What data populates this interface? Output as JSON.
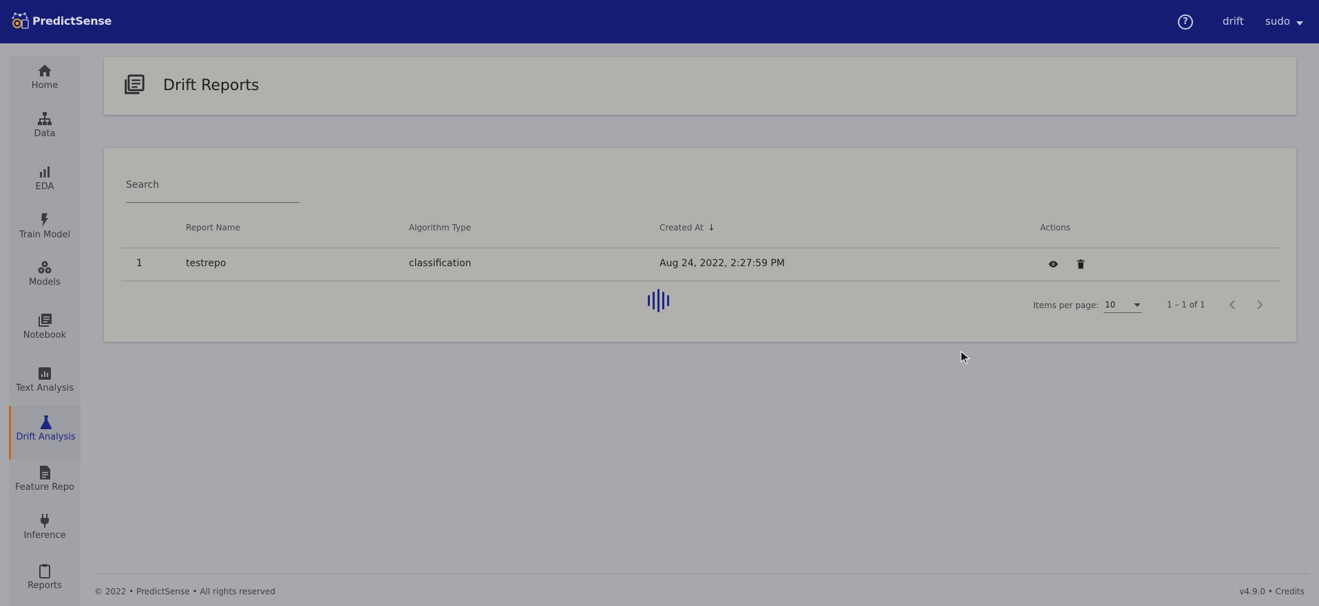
{
  "app": {
    "brand": "PredictSense",
    "colors": {
      "topbar": "#141c74",
      "accent": "#1d2680",
      "active_marker": "#c36520",
      "loader": "#1d2680"
    }
  },
  "topbar": {
    "help_icon": "question-circle-icon",
    "help_glyph": "?",
    "project": "drift",
    "user": "sudo"
  },
  "sidebar": {
    "items": [
      {
        "label": "Home",
        "icon": "home-icon",
        "active": false
      },
      {
        "label": "Data",
        "icon": "hierarchy-icon",
        "active": false
      },
      {
        "label": "EDA",
        "icon": "bar-chart-icon",
        "active": false
      },
      {
        "label": "Train Model",
        "icon": "bolt-icon",
        "active": false
      },
      {
        "label": "Models",
        "icon": "cubes-icon",
        "active": false
      },
      {
        "label": "Notebook",
        "icon": "notebook-icon",
        "active": false
      },
      {
        "label": "Text Analysis",
        "icon": "analytics-icon",
        "active": false
      },
      {
        "label": "Drift Analysis",
        "icon": "flask-icon",
        "active": true
      },
      {
        "label": "Feature Repo",
        "icon": "document-icon",
        "active": false
      },
      {
        "label": "Inference",
        "icon": "plug-icon",
        "active": false
      },
      {
        "label": "Reports",
        "icon": "clipboard-icon",
        "active": false
      }
    ]
  },
  "page": {
    "title": "Drift Reports",
    "header_icon": "library-books-icon"
  },
  "search": {
    "placeholder": "Search",
    "value": ""
  },
  "table": {
    "columns": {
      "report_name": "Report Name",
      "algorithm_type": "Algorithm Type",
      "created_at": "Created At",
      "sort_arrow": "↓",
      "actions": "Actions"
    },
    "rows": [
      {
        "index": "1",
        "report_name": "testrepo",
        "algorithm_type": "classification",
        "created_at": "Aug 24, 2022, 2:27:59 PM",
        "actions": [
          "eye-icon",
          "trash-icon"
        ]
      }
    ]
  },
  "paginator": {
    "items_per_page_label": "Items per page:",
    "items_per_page_value": "10",
    "range": "1 – 1 of 1"
  },
  "footer": {
    "left": "© 2022 • PredictSense • All rights reserved",
    "right": "v4.9.0 • Credits"
  }
}
